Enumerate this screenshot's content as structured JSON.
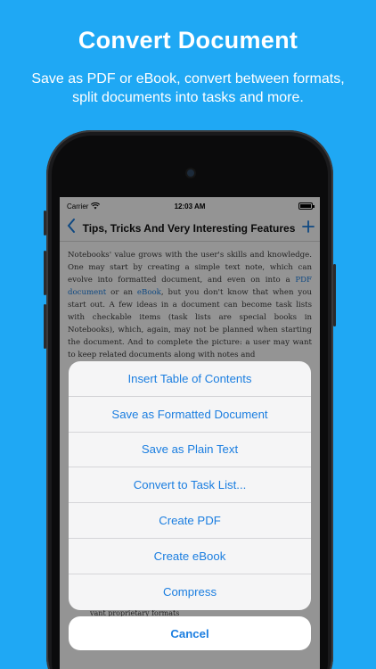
{
  "promo": {
    "title": "Convert Document",
    "subtitle": "Save as PDF or eBook, convert between formats, split documents into tasks and more."
  },
  "status_bar": {
    "carrier": "Carrier",
    "time": "12:03 AM"
  },
  "nav": {
    "title": "Tips, Tricks And Very Interesting Features",
    "back_icon": "chevron-left-icon",
    "add_icon": "plus-icon"
  },
  "document": {
    "text_part1": "Notebooks' value grows with the user's skills and knowledge. One may start by creating a simple text note, which can evolve into formatted document, and even on into a ",
    "link1": "PDF document",
    "text_part2": " or an ",
    "link2": "eBook",
    "text_part3": ", but you don't know that when you start out. A few ideas in a document can become task lists with checkable items (task lists are special books in Notebooks), which, again, may not be planned when starting the document. And to complete the picture: a user may want to keep related documents along with notes and",
    "tail": "vant proprietary formats"
  },
  "action_sheet": {
    "items": [
      "Insert Table of Contents",
      "Save as Formatted Document",
      "Save as Plain Text",
      "Convert to Task List...",
      "Create PDF",
      "Create eBook",
      "Compress"
    ],
    "cancel": "Cancel"
  },
  "colors": {
    "background": "#1fa8f4",
    "accent": "#1b7ee0"
  }
}
